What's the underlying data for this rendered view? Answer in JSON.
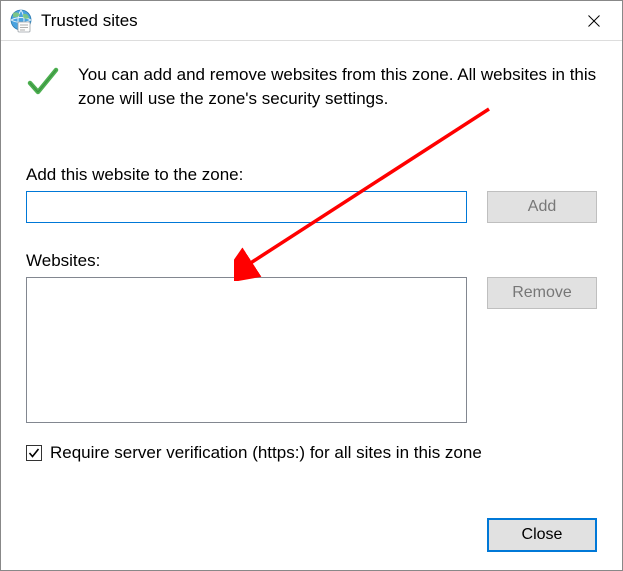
{
  "titlebar": {
    "title": "Trusted sites"
  },
  "info": {
    "text": "You can add and remove websites from this zone. All websites in this zone will use the zone's security settings."
  },
  "addSection": {
    "label": "Add this website to the zone:",
    "inputValue": "",
    "addButton": "Add"
  },
  "listSection": {
    "label": "Websites:",
    "items": [],
    "removeButton": "Remove"
  },
  "verification": {
    "checked": true,
    "label": "Require server verification (https:) for all sites in this zone"
  },
  "footer": {
    "closeButton": "Close"
  },
  "annotation": {
    "arrowColor": "#ff0000"
  }
}
